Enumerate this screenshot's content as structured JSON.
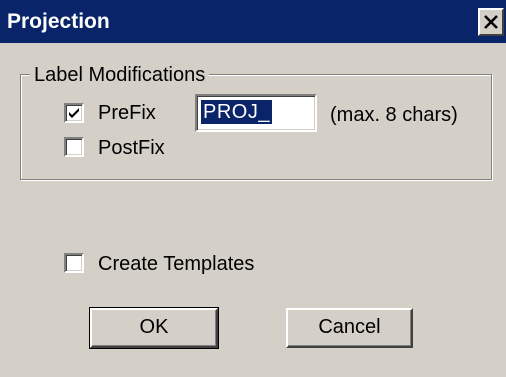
{
  "window": {
    "title": "Projection",
    "close_icon": "close-icon"
  },
  "label_modifications": {
    "legend": "Label Modifications",
    "prefix": {
      "label": "PreFix",
      "checked": true,
      "value": "PROJ_",
      "hint": "(max. 8 chars)"
    },
    "postfix": {
      "label": "PostFix",
      "checked": false
    }
  },
  "create_templates": {
    "label": "Create Templates",
    "checked": false
  },
  "buttons": {
    "ok": "OK",
    "cancel": "Cancel"
  },
  "colors": {
    "titlebar": "#0a246a",
    "face": "#d4d0c8",
    "selection": "#0a246a"
  }
}
